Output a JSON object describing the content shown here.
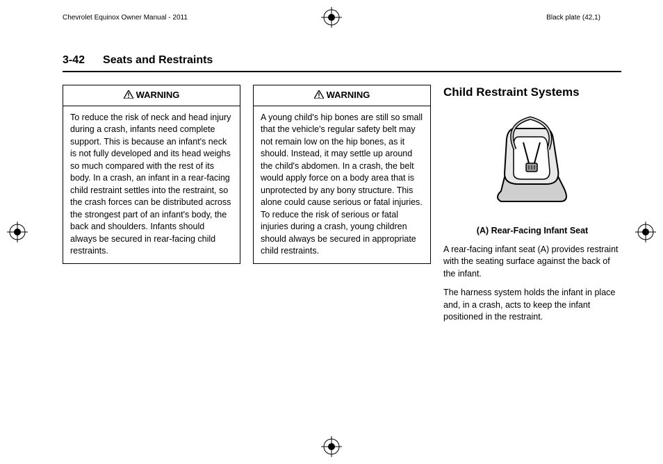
{
  "header": {
    "manual_title": "Chevrolet Equinox Owner Manual - 2011",
    "plate_info": "Black plate (42,1)"
  },
  "section": {
    "page_number": "3-42",
    "title": "Seats and Restraints"
  },
  "warning_label": "WARNING",
  "warnings": [
    {
      "body": "To reduce the risk of neck and head injury during a crash, infants need complete support. This is because an infant's neck is not fully developed and its head weighs so much compared with the rest of its body. In a crash, an infant in a rear-facing child restraint settles into the restraint, so the crash forces can be distributed across the strongest part of an infant's body, the back and shoulders. Infants should always be secured in rear-facing child restraints."
    },
    {
      "body": "A young child's hip bones are still so small that the vehicle's regular safety belt may not remain low on the hip bones, as it should. Instead, it may settle up around the child's abdomen. In a crash, the belt would apply force on a body area that is unprotected by any bony structure. This alone could cause serious or fatal injuries. To reduce the risk of serious or fatal injuries during a crash, young children should always be secured in appropriate child restraints."
    }
  ],
  "right": {
    "heading": "Child Restraint Systems",
    "caption": "(A) Rear-Facing Infant Seat",
    "para1": "A rear-facing infant seat (A) provides restraint with the seating surface against the back of the infant.",
    "para2": "The harness system holds the infant in place and, in a crash, acts to keep the infant positioned in the restraint."
  }
}
